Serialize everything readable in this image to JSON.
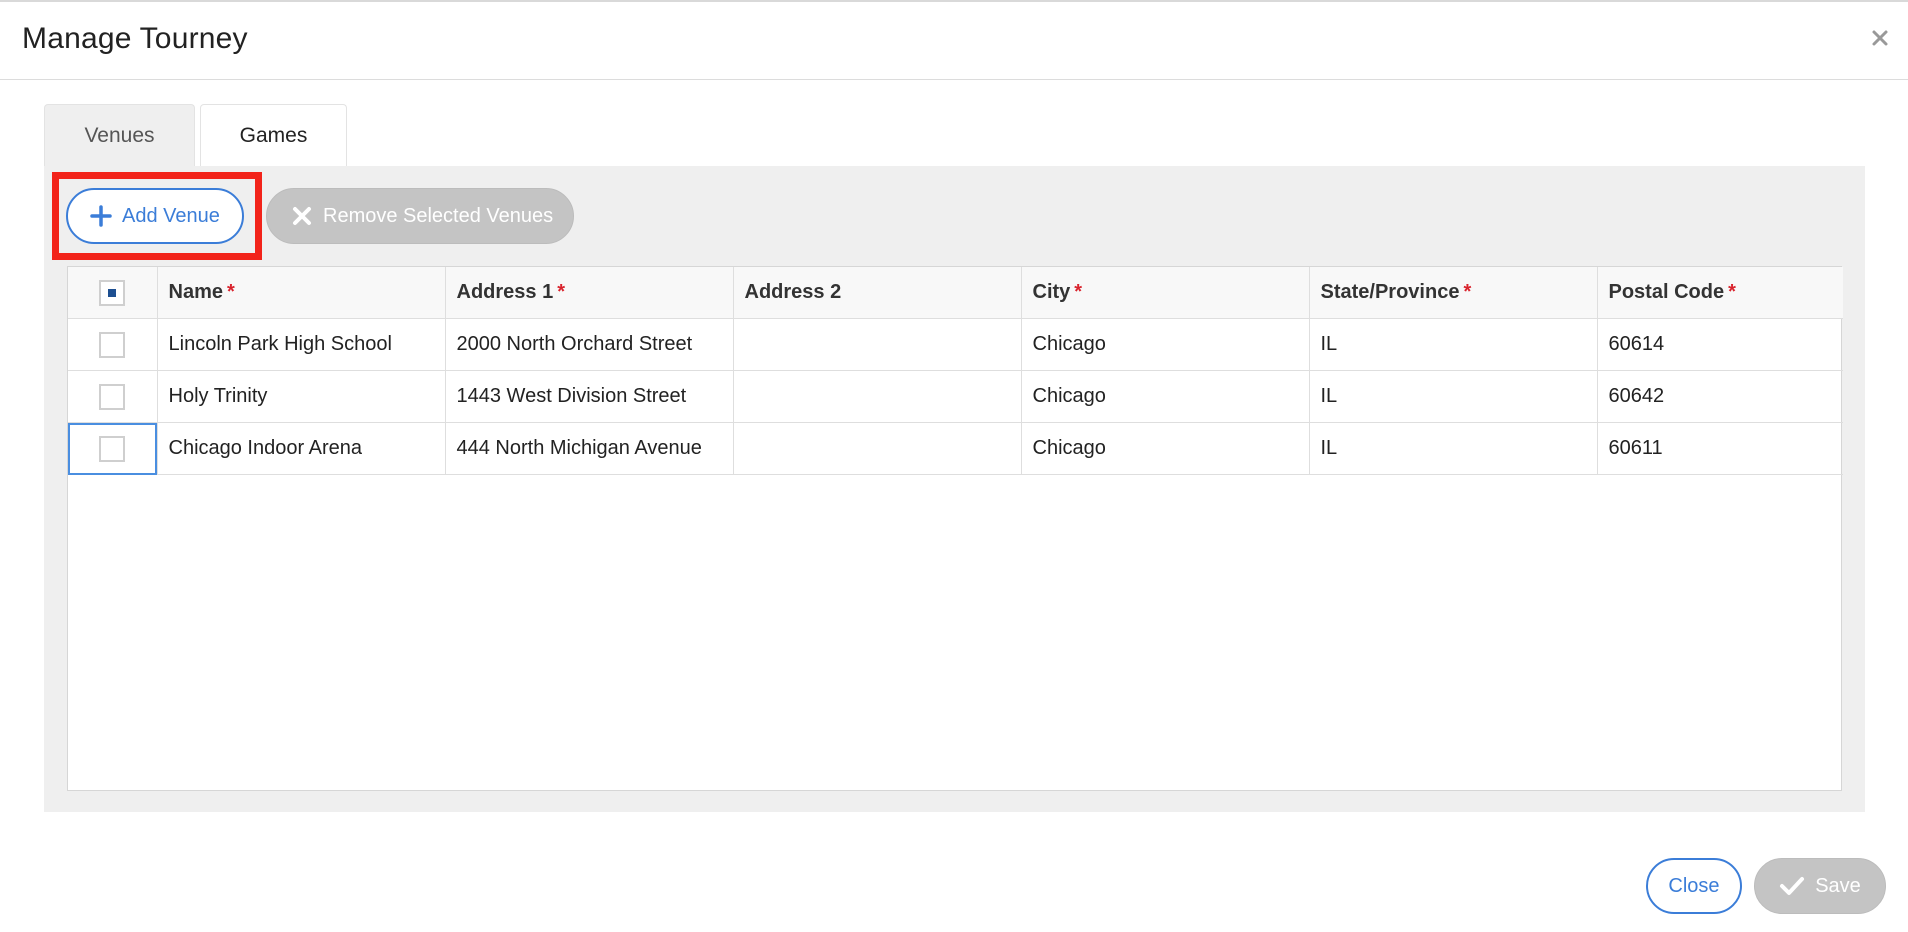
{
  "dialog": {
    "title": "Manage Tourney"
  },
  "tabs": [
    {
      "label": "Venues"
    },
    {
      "label": "Games"
    }
  ],
  "toolbar": {
    "add_label": "Add Venue",
    "remove_label": "Remove Selected Venues"
  },
  "table": {
    "columns": [
      {
        "label": "Name",
        "required": "*"
      },
      {
        "label": "Address 1",
        "required": "*"
      },
      {
        "label": "Address 2",
        "required": ""
      },
      {
        "label": "City",
        "required": "*"
      },
      {
        "label": "State/Province",
        "required": "*"
      },
      {
        "label": "Postal Code",
        "required": "*"
      }
    ],
    "rows": [
      {
        "name": "Lincoln Park High School",
        "address1": "2000 North Orchard Street",
        "address2": "",
        "city": "Chicago",
        "state": "IL",
        "postal": "60614"
      },
      {
        "name": "Holy Trinity",
        "address1": "1443 West Division Street",
        "address2": "",
        "city": "Chicago",
        "state": "IL",
        "postal": "60642"
      },
      {
        "name": "Chicago Indoor Arena",
        "address1": "444 North Michigan Avenue",
        "address2": "",
        "city": "Chicago",
        "state": "IL",
        "postal": "60611"
      }
    ]
  },
  "footer": {
    "close_label": "Close",
    "save_label": "Save"
  },
  "colors": {
    "accent": "#3b7dd8",
    "highlight": "#f2231a",
    "required": "#d9232d",
    "disabled": "#c4c4c4"
  },
  "icons": {
    "close": "close-icon",
    "add": "plus-icon",
    "remove": "x-icon",
    "save": "check-icon"
  }
}
